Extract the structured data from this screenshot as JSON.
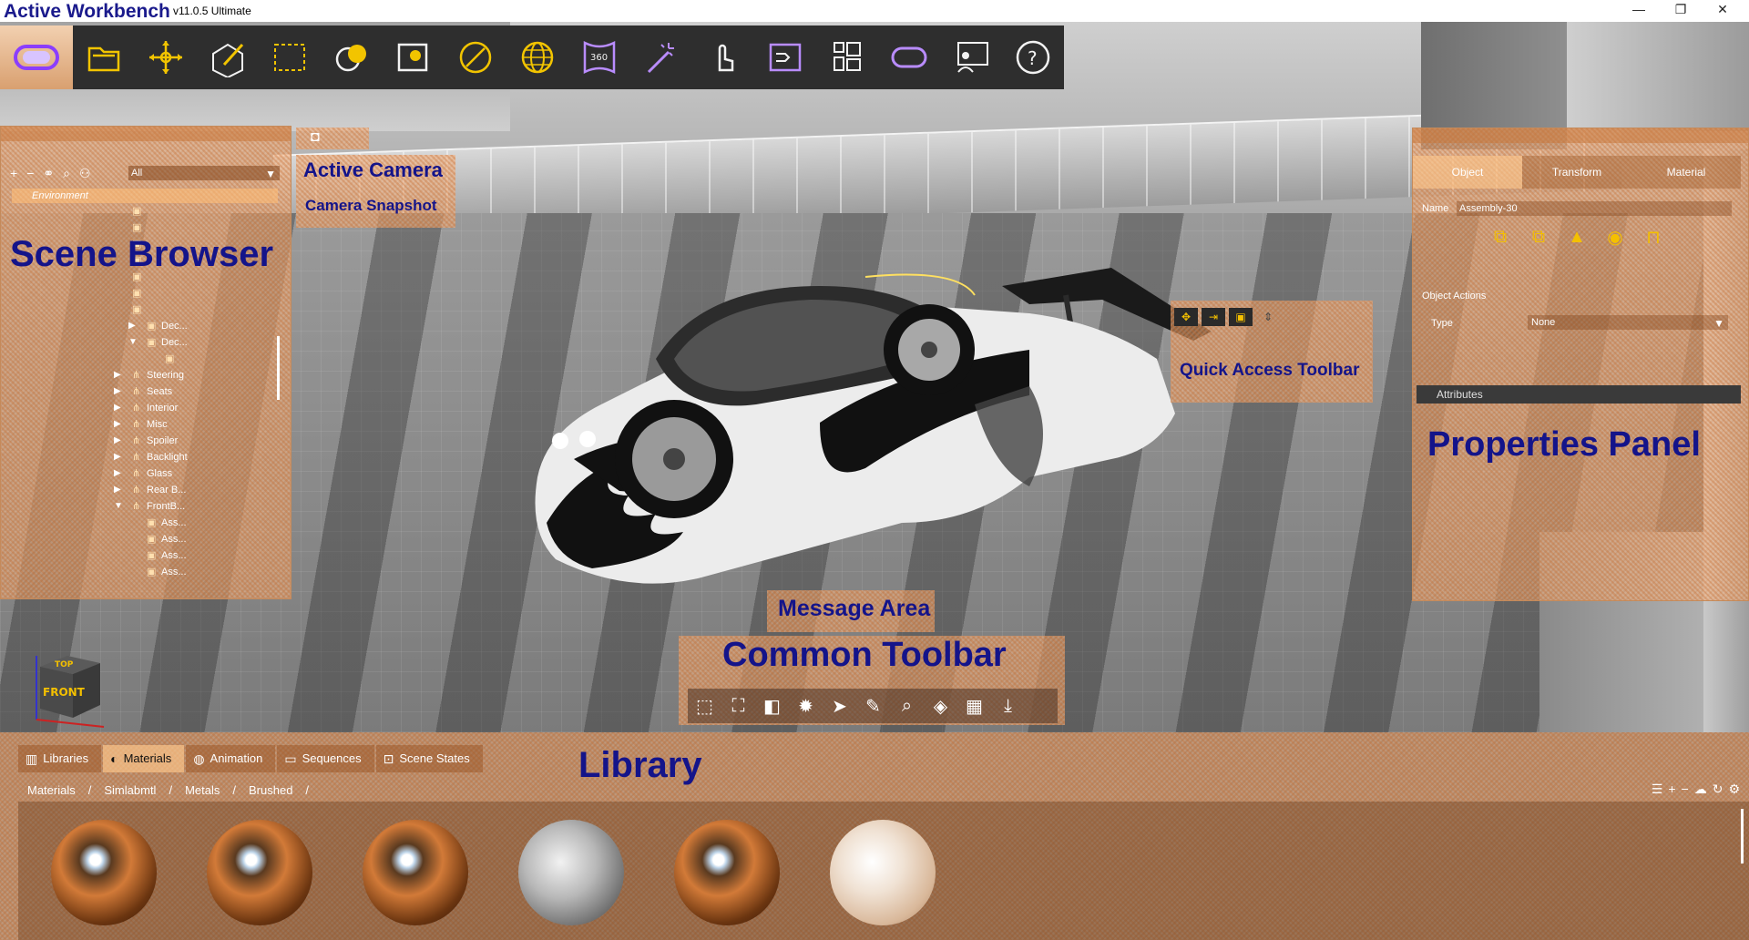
{
  "window": {
    "title": "Active Workbench",
    "version": "v11.0.5 Ultimate",
    "minimize_glyph": "—",
    "maximize_glyph": "❐",
    "close_glyph": "✕"
  },
  "main_toolbar": {
    "buttons": [
      "vr-headset-icon",
      "open-folder-icon",
      "transform-icon",
      "edit-icon",
      "select-box-icon",
      "lighting-icon",
      "camera-icon",
      "material-icon",
      "globe-icon",
      "view-360-icon",
      "magic-wand-icon",
      "touch-icon",
      "sequence-icon",
      "layout-icon",
      "vr-mode-icon",
      "presentation-icon",
      "help-icon"
    ]
  },
  "labels": {
    "scene_browser": "Scene Browser",
    "active_camera": "Active Camera",
    "camera_snapshot": "Camera Snapshot",
    "quick_access_toolbar": "Quick Access Toolbar",
    "properties_panel": "Properties Panel",
    "message_area": "Message Area",
    "common_toolbar": "Common Toolbar",
    "library": "Library"
  },
  "scene_browser": {
    "filter": "All",
    "environment": "Environment",
    "tree": [
      {
        "indent": 0,
        "label": "",
        "arrow": ""
      },
      {
        "indent": 0,
        "label": "",
        "arrow": ""
      },
      {
        "indent": 0,
        "label": "",
        "arrow": ""
      },
      {
        "indent": 0,
        "label": "",
        "arrow": ""
      },
      {
        "indent": 0,
        "label": "",
        "arrow": ""
      },
      {
        "indent": 0,
        "label": "",
        "arrow": ""
      },
      {
        "indent": 0,
        "label": "",
        "arrow": ""
      },
      {
        "indent": 1,
        "label": "Dec...",
        "arrow": "▶"
      },
      {
        "indent": 1,
        "label": "Dec...",
        "arrow": "▼"
      },
      {
        "indent": 2,
        "label": "",
        "arrow": ""
      },
      {
        "indent": 0,
        "label": "Steering",
        "arrow": "▶"
      },
      {
        "indent": 0,
        "label": "Seats",
        "arrow": "▶"
      },
      {
        "indent": 0,
        "label": "Interior",
        "arrow": "▶"
      },
      {
        "indent": 0,
        "label": "Misc",
        "arrow": "▶"
      },
      {
        "indent": 0,
        "label": "Spoiler",
        "arrow": "▶"
      },
      {
        "indent": 0,
        "label": "Backlight",
        "arrow": "▶"
      },
      {
        "indent": 0,
        "label": "Glass",
        "arrow": "▶"
      },
      {
        "indent": 0,
        "label": "Rear B...",
        "arrow": "▶"
      },
      {
        "indent": 0,
        "label": "FrontB...",
        "arrow": "▼"
      },
      {
        "indent": 1,
        "label": "Ass...",
        "arrow": ""
      },
      {
        "indent": 1,
        "label": "Ass...",
        "arrow": ""
      },
      {
        "indent": 1,
        "label": "Ass...",
        "arrow": ""
      },
      {
        "indent": 1,
        "label": "Ass...",
        "arrow": ""
      }
    ]
  },
  "properties": {
    "tabs": [
      "Object",
      "Transform",
      "Material"
    ],
    "active_tab": "Object",
    "name_label": "Name",
    "name_value": "Assembly-30",
    "object_actions_label": "Object Actions",
    "type_label": "Type",
    "type_value": "None",
    "attributes_label": "Attributes"
  },
  "orientation_cube": {
    "top": "TOP",
    "front": "FRONT"
  },
  "library": {
    "tabs": [
      {
        "label": "Libraries",
        "icon": "books-icon"
      },
      {
        "label": "Materials",
        "icon": "palette-icon"
      },
      {
        "label": "Animation",
        "icon": "animation-icon"
      },
      {
        "label": "Sequences",
        "icon": "folder-icon"
      },
      {
        "label": "Scene States",
        "icon": "scene-state-icon"
      }
    ],
    "active_tab": "Materials",
    "breadcrumb": [
      "Materials",
      "/",
      "Simlabmtl",
      "/",
      "Metals",
      "/",
      "Brushed",
      "/"
    ],
    "materials": [
      "copper",
      "copper",
      "copper",
      "silver-copper",
      "copper",
      "pearl"
    ]
  },
  "colors": {
    "accent_text": "#14148a",
    "overlay_orange": "#f0a064",
    "toolbar_bg": "#2e2e2e",
    "icon_purple": "#b98cff",
    "icon_white": "#f2f2f2"
  }
}
